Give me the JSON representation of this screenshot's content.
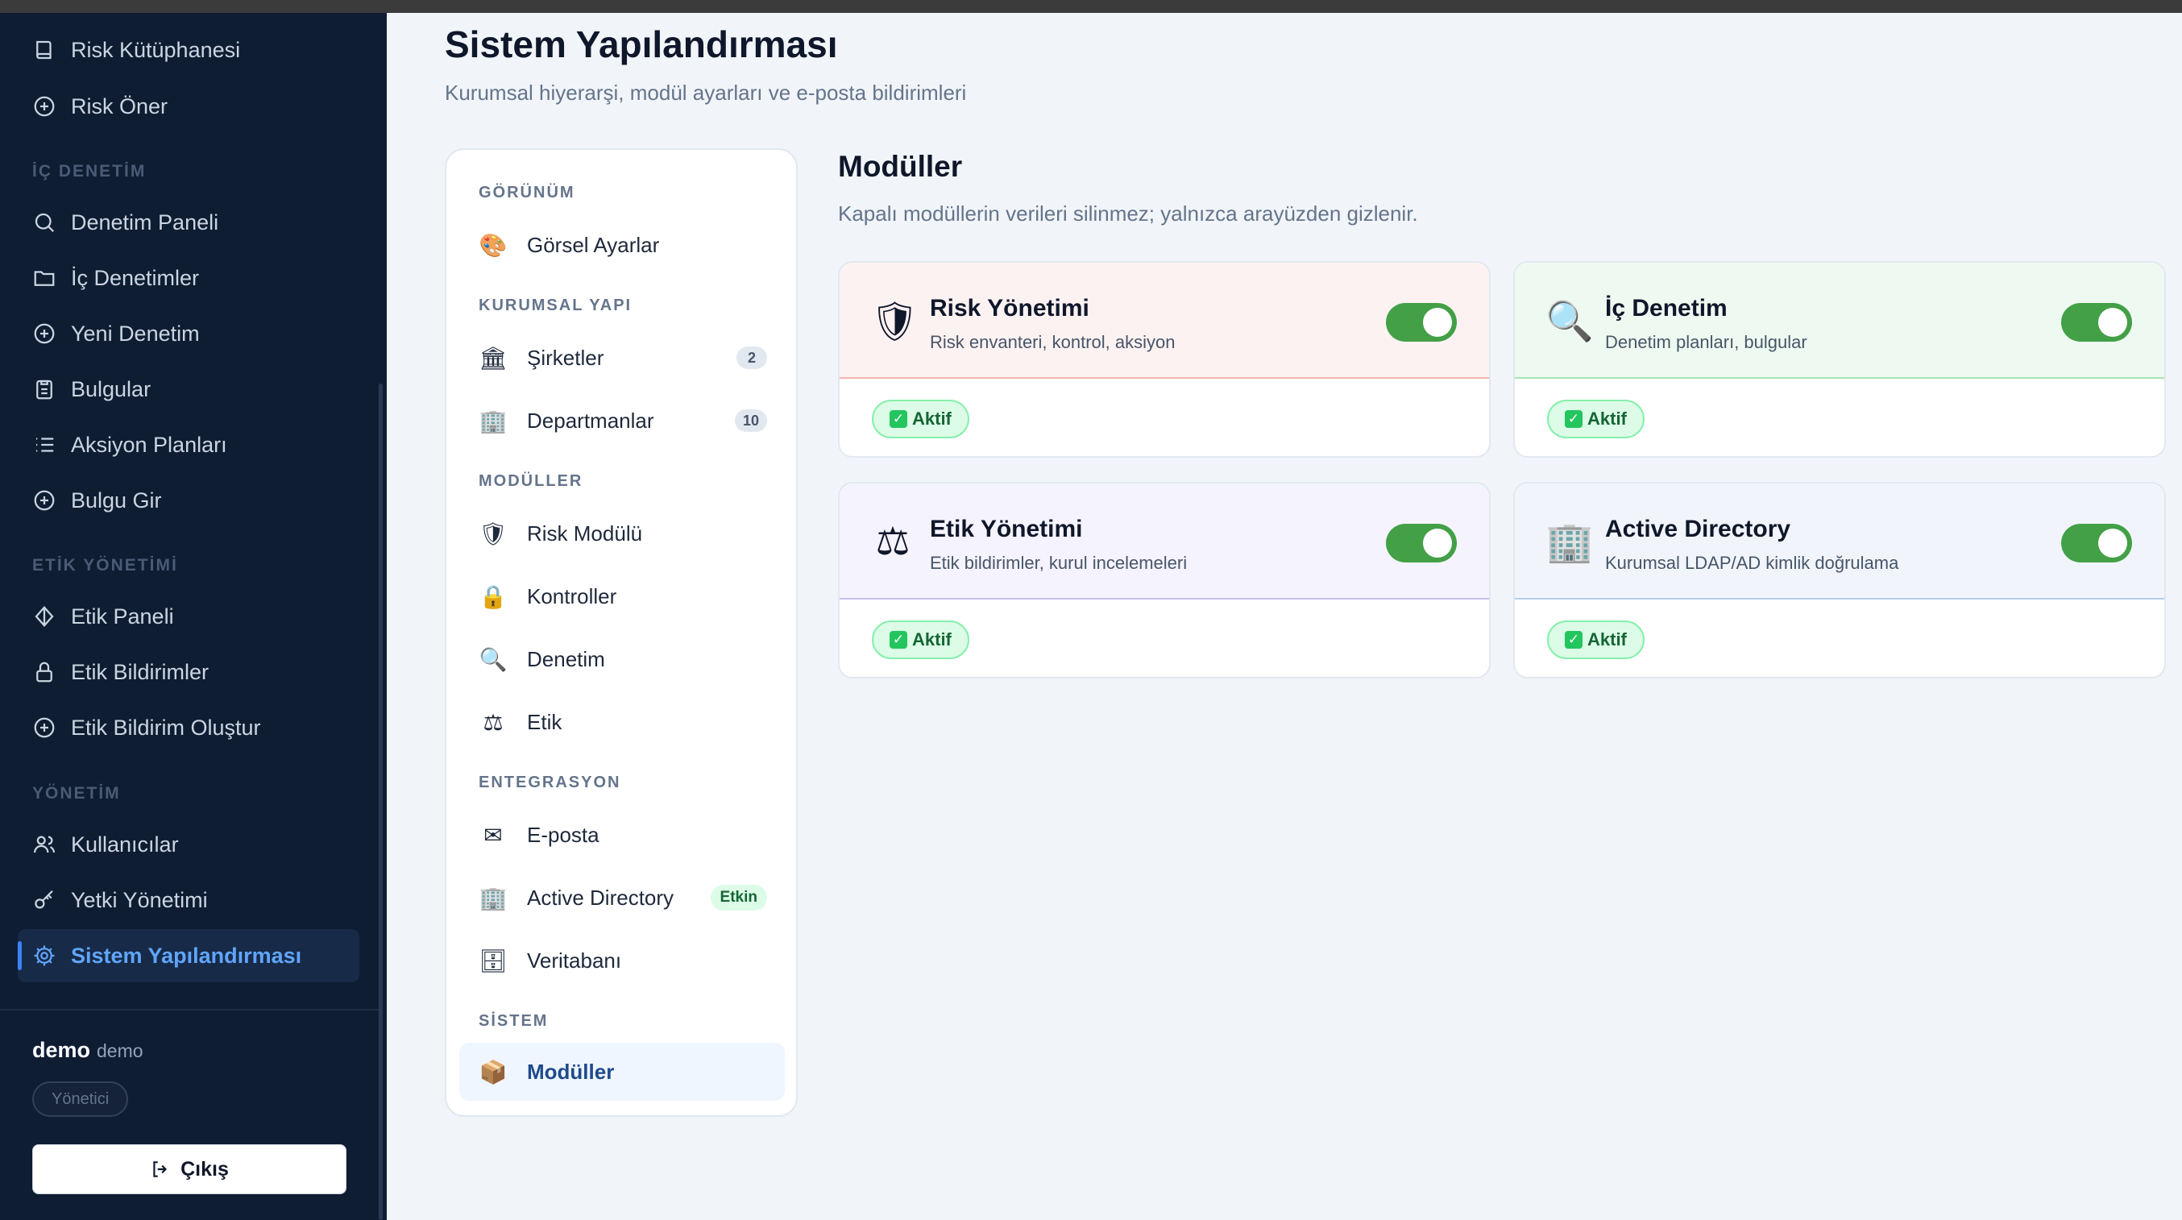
{
  "sidebar": {
    "top_items": [
      {
        "label": "Risk Kütüphanesi",
        "icon": "book-icon"
      },
      {
        "label": "Risk Öner",
        "icon": "plus-circle-icon"
      }
    ],
    "sections": {
      "ic_denetim": "İÇ DENETİM",
      "etik": "ETİK YÖNETİMİ",
      "yonetim": "YÖNETİM"
    },
    "ic_denetim_items": [
      {
        "label": "Denetim Paneli",
        "icon": "search-icon"
      },
      {
        "label": "İç Denetimler",
        "icon": "folder-icon"
      },
      {
        "label": "Yeni Denetim",
        "icon": "plus-circle-icon"
      },
      {
        "label": "Bulgular",
        "icon": "clipboard-icon"
      },
      {
        "label": "Aksiyon Planları",
        "icon": "list-icon"
      },
      {
        "label": "Bulgu Gir",
        "icon": "plus-circle-icon"
      }
    ],
    "etik_items": [
      {
        "label": "Etik Paneli",
        "icon": "diamond-icon"
      },
      {
        "label": "Etik Bildirimler",
        "icon": "lock-icon"
      },
      {
        "label": "Etik Bildirim Oluştur",
        "icon": "plus-circle-icon"
      }
    ],
    "yonetim_items": [
      {
        "label": "Kullanıcılar",
        "icon": "users-icon"
      },
      {
        "label": "Yetki Yönetimi",
        "icon": "key-icon"
      },
      {
        "label": "Sistem Yapılandırması",
        "icon": "gear-icon"
      }
    ],
    "user": {
      "name": "demo",
      "username": "demo",
      "role": "Yönetici"
    },
    "logout_label": "Çıkış"
  },
  "main": {
    "title": "Sistem Yapılandırması",
    "subtitle": "Kurumsal hiyerarşi, modül ayarları ve e-posta bildirimleri"
  },
  "settings_nav": {
    "sections": {
      "gorunum": "GÖRÜNÜM",
      "kurumsal": "KURUMSAL YAPI",
      "moduller": "MODÜLLER",
      "entegrasyon": "ENTEGRASYON",
      "sistem": "SİSTEM"
    },
    "items": {
      "gorsel": {
        "label": "Görsel Ayarlar",
        "emoji": "🎨"
      },
      "sirketler": {
        "label": "Şirketler",
        "emoji": "🏛",
        "count": "2"
      },
      "departmanlar": {
        "label": "Departmanlar",
        "emoji": "🏢",
        "count": "10"
      },
      "risk_modulu": {
        "label": "Risk Modülü",
        "emoji": "🛡"
      },
      "kontroller": {
        "label": "Kontroller",
        "emoji": "🔒"
      },
      "denetim": {
        "label": "Denetim",
        "emoji": "🔍"
      },
      "etik": {
        "label": "Etik",
        "emoji": "⚖"
      },
      "eposta": {
        "label": "E-posta",
        "emoji": "✉"
      },
      "active_directory": {
        "label": "Active Directory",
        "emoji": "🏢",
        "badge": "Etkin"
      },
      "veritabani": {
        "label": "Veritabanı",
        "emoji": "🗄"
      },
      "moduller": {
        "label": "Modüller",
        "emoji": "📦"
      }
    }
  },
  "modules_panel": {
    "title": "Modüller",
    "subtitle": "Kapalı modüllerin verileri silinmez; yalnızca arayüzden gizlenir.",
    "cards": [
      {
        "title": "Risk Yönetimi",
        "desc": "Risk envanteri, kontrol, aksiyon",
        "icon": "🛡",
        "status": "Aktif",
        "enabled": true,
        "tint": "#fdf2f2",
        "line": "#f3b4b4"
      },
      {
        "title": "İç Denetim",
        "desc": "Denetim planları, bulgular",
        "icon": "🔍",
        "status": "Aktif",
        "enabled": true,
        "tint": "#eefaf1",
        "line": "#a7e3b7"
      },
      {
        "title": "Etik Yönetimi",
        "desc": "Etik bildirimler, kurul incelemeleri",
        "icon": "⚖",
        "status": "Aktif",
        "enabled": true,
        "tint": "#f5f3fd",
        "line": "#c9bff0"
      },
      {
        "title": "Active Directory",
        "desc": "Kurumsal LDAP/AD kimlik doğrulama",
        "icon": "🏢",
        "status": "Aktif",
        "enabled": true,
        "tint": "#f1f5fb",
        "line": "#b6cde9"
      }
    ]
  },
  "colors": {
    "sidebar_bg": "#0f1d33",
    "accent": "#3b82f6",
    "toggle_on": "#43a047",
    "active_badge": "#166534"
  }
}
